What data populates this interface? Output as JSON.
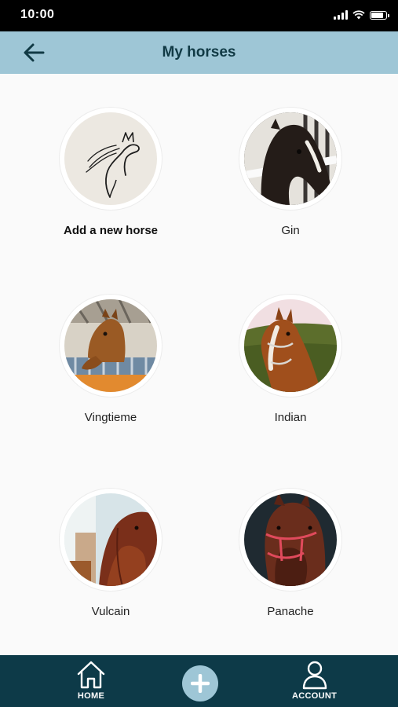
{
  "status_bar": {
    "time": "10:00",
    "icons": [
      "signal-icon",
      "wifi-icon",
      "battery-icon"
    ]
  },
  "header": {
    "title": "My horses",
    "back_icon": "arrow-left-icon",
    "background_color": "#9ec6d6"
  },
  "horses": [
    {
      "name": "Add a new horse",
      "icon": "horse-outline-icon"
    },
    {
      "name": "Gin"
    },
    {
      "name": "Vingtieme"
    },
    {
      "name": "Indian"
    },
    {
      "name": "Vulcain"
    },
    {
      "name": "Panache"
    }
  ],
  "bottom_nav": {
    "home_label": "HOME",
    "home_icon": "home-icon",
    "add_icon": "plus-icon",
    "account_label": "ACCOUNT",
    "account_icon": "user-icon",
    "background_color": "#0d3a48"
  }
}
